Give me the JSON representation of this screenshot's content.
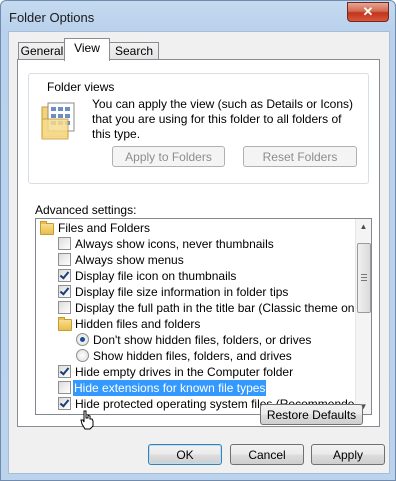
{
  "window": {
    "title": "Folder Options",
    "close_glyph": "✕"
  },
  "tabs": [
    {
      "label": "General",
      "active": false
    },
    {
      "label": "View",
      "active": true
    },
    {
      "label": "Search",
      "active": false
    }
  ],
  "folder_views": {
    "label": "Folder views",
    "description": "You can apply the view (such as Details or Icons) that you are using for this folder to all folders of this type.",
    "apply_button": "Apply to Folders",
    "reset_button": "Reset Folders",
    "icon": "folder-views-icon"
  },
  "advanced": {
    "label": "Advanced settings:",
    "items": [
      {
        "type": "folder",
        "label": "Files and Folders"
      },
      {
        "type": "checkbox",
        "label": "Always show icons, never thumbnails",
        "checked": false
      },
      {
        "type": "checkbox",
        "label": "Always show menus",
        "checked": false
      },
      {
        "type": "checkbox",
        "label": "Display file icon on thumbnails",
        "checked": true
      },
      {
        "type": "checkbox",
        "label": "Display file size information in folder tips",
        "checked": true
      },
      {
        "type": "checkbox",
        "label": "Display the full path in the title bar (Classic theme only)",
        "checked": false
      },
      {
        "type": "folder",
        "label": "Hidden files and folders"
      },
      {
        "type": "radio",
        "label": "Don't show hidden files, folders, or drives",
        "checked": true
      },
      {
        "type": "radio",
        "label": "Show hidden files, folders, and drives",
        "checked": false
      },
      {
        "type": "checkbox",
        "label": "Hide empty drives in the Computer folder",
        "checked": true
      },
      {
        "type": "checkbox",
        "label": "Hide extensions for known file types",
        "checked": false,
        "selected": true
      },
      {
        "type": "checkbox",
        "label": "Hide protected operating system files (Recommended)",
        "checked": true
      }
    ]
  },
  "restore_button": "Restore Defaults",
  "footer": {
    "ok": "OK",
    "cancel": "Cancel",
    "apply": "Apply"
  },
  "colors": {
    "selection": "#3399ff",
    "accent": "#3c7fb1"
  }
}
